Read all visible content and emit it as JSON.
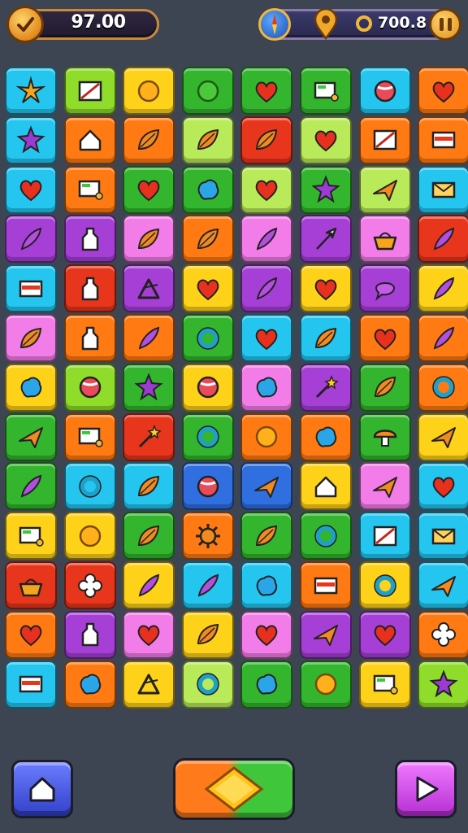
{
  "hud": {
    "score": "97.00",
    "gold": "700.8"
  },
  "colors": {
    "cyan": "#24c6f0",
    "lime": "#8fdc2a",
    "yellow": "#ffd21a",
    "green": "#33b52e",
    "orange": "#ff7a12",
    "red": "#e8361c",
    "purple": "#a63fd6",
    "pink": "#f27de8",
    "blue": "#2f6fe0",
    "lightgreen": "#b9ea5a",
    "lightcyan": "#58d7f5"
  },
  "board": {
    "rows": [
      [
        [
          "cyan",
          "star-burst"
        ],
        [
          "lime",
          "picture"
        ],
        [
          "yellow",
          "coin"
        ],
        [
          "green",
          "circle"
        ],
        [
          "green",
          "heart"
        ],
        [
          "green",
          "monitor"
        ],
        [
          "cyan",
          "ball"
        ],
        [
          "orange",
          "heart"
        ]
      ],
      [
        [
          "cyan",
          "star"
        ],
        [
          "orange",
          "house"
        ],
        [
          "orange",
          "leaf"
        ],
        [
          "lightgreen",
          "leaf"
        ],
        [
          "red",
          "leaf"
        ],
        [
          "lightgreen",
          "heart"
        ],
        [
          "orange",
          "picture"
        ],
        [
          "orange",
          "card"
        ]
      ],
      [
        [
          "cyan",
          "heart"
        ],
        [
          "orange",
          "monitor"
        ],
        [
          "green",
          "heart"
        ],
        [
          "green",
          "blob"
        ],
        [
          "lightgreen",
          "heart"
        ],
        [
          "green",
          "star"
        ],
        [
          "lightgreen",
          "plane"
        ],
        [
          "cyan",
          "mail"
        ]
      ],
      [
        [
          "purple",
          "feather"
        ],
        [
          "purple",
          "bottle"
        ],
        [
          "pink",
          "leaf"
        ],
        [
          "orange",
          "leaf"
        ],
        [
          "pink",
          "feather"
        ],
        [
          "purple",
          "arrow"
        ],
        [
          "pink",
          "basket"
        ],
        [
          "red",
          "feather"
        ]
      ],
      [
        [
          "cyan",
          "card"
        ],
        [
          "red",
          "bottle"
        ],
        [
          "purple",
          "triangle"
        ],
        [
          "yellow",
          "heart"
        ],
        [
          "purple",
          "feather"
        ],
        [
          "yellow",
          "heart"
        ],
        [
          "purple",
          "bubble"
        ],
        [
          "yellow",
          "feather"
        ]
      ],
      [
        [
          "pink",
          "leaf"
        ],
        [
          "orange",
          "bottle"
        ],
        [
          "orange",
          "feather"
        ],
        [
          "green",
          "ring"
        ],
        [
          "cyan",
          "heart"
        ],
        [
          "cyan",
          "leaf"
        ],
        [
          "orange",
          "heart"
        ],
        [
          "orange",
          "feather"
        ]
      ],
      [
        [
          "yellow",
          "blob"
        ],
        [
          "lime",
          "ball"
        ],
        [
          "green",
          "star"
        ],
        [
          "yellow",
          "ball"
        ],
        [
          "pink",
          "blob"
        ],
        [
          "purple",
          "wand"
        ],
        [
          "green",
          "leaf"
        ],
        [
          "orange",
          "ring"
        ]
      ],
      [
        [
          "green",
          "plane"
        ],
        [
          "orange",
          "monitor"
        ],
        [
          "red",
          "wand"
        ],
        [
          "green",
          "ring"
        ],
        [
          "orange",
          "coin"
        ],
        [
          "orange",
          "blob"
        ],
        [
          "green",
          "mushroom"
        ],
        [
          "yellow",
          "plane"
        ]
      ],
      [
        [
          "green",
          "feather"
        ],
        [
          "cyan",
          "ring"
        ],
        [
          "cyan",
          "leaf"
        ],
        [
          "blue",
          "ball"
        ],
        [
          "blue",
          "plane"
        ],
        [
          "yellow",
          "house"
        ],
        [
          "pink",
          "plane"
        ],
        [
          "cyan",
          "heart"
        ]
      ],
      [
        [
          "yellow",
          "monitor"
        ],
        [
          "yellow",
          "coin"
        ],
        [
          "green",
          "leaf"
        ],
        [
          "orange",
          "gear"
        ],
        [
          "green",
          "leaf"
        ],
        [
          "green",
          "ring"
        ],
        [
          "cyan",
          "picture"
        ],
        [
          "cyan",
          "mail"
        ]
      ],
      [
        [
          "red",
          "basket"
        ],
        [
          "red",
          "flower"
        ],
        [
          "yellow",
          "feather"
        ],
        [
          "cyan",
          "feather"
        ],
        [
          "cyan",
          "blob"
        ],
        [
          "orange",
          "card"
        ],
        [
          "yellow",
          "ring"
        ],
        [
          "cyan",
          "plane"
        ]
      ],
      [
        [
          "orange",
          "heart"
        ],
        [
          "purple",
          "bottle"
        ],
        [
          "pink",
          "heart"
        ],
        [
          "yellow",
          "leaf"
        ],
        [
          "pink",
          "heart"
        ],
        [
          "purple",
          "plane"
        ],
        [
          "purple",
          "heart"
        ],
        [
          "orange",
          "flower"
        ]
      ],
      [
        [
          "cyan",
          "card"
        ],
        [
          "orange",
          "blob"
        ],
        [
          "yellow",
          "triangle"
        ],
        [
          "lightgreen",
          "ring"
        ],
        [
          "green",
          "blob"
        ],
        [
          "green",
          "coin"
        ],
        [
          "yellow",
          "monitor"
        ],
        [
          "lime",
          "star"
        ]
      ]
    ]
  },
  "buttons": {
    "home": "house-icon",
    "center": "diamond-icon",
    "play": "play-icon"
  }
}
